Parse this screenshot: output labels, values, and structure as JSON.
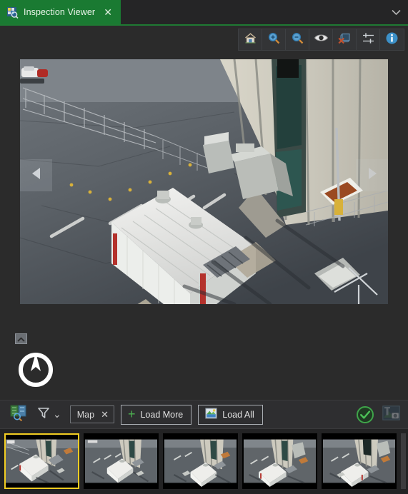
{
  "window": {
    "tab": {
      "label": "Inspection Viewer",
      "icon": "inspection-grid-magnifier-icon",
      "close_label": "✕",
      "active": true,
      "accent_color": "#1a7a32"
    },
    "chevron": "⌄",
    "background_color": "#2b2b2b"
  },
  "toolbar": {
    "buttons": [
      {
        "name": "home-reset-view",
        "icon": "home-icon",
        "label": "Home"
      },
      {
        "name": "zoom-in",
        "icon": "zoom-in-icon",
        "label": "Zoom In"
      },
      {
        "name": "zoom-out",
        "icon": "zoom-out-icon",
        "label": "Zoom Out"
      },
      {
        "name": "visibility-toggle",
        "icon": "eye-icon",
        "label": "Show / Hide"
      },
      {
        "name": "clear-annotations",
        "icon": "delete-shape-icon",
        "label": "Clear"
      },
      {
        "name": "image-adjustments",
        "icon": "sliders-icon",
        "label": "Adjustments"
      },
      {
        "name": "information",
        "icon": "info-icon",
        "label": "Information"
      }
    ],
    "accent_blue": "#3c90c8",
    "accent_red": "#c0512e"
  },
  "viewer": {
    "prev_arrow": "◀",
    "next_arrow": "▶",
    "collapse_icon": "chevron-up-icon",
    "compass_icon": "compass-north-icon",
    "photo_alt": "Aerial inspection photo of building facade with parking lot and white container roof"
  },
  "actionbar": {
    "map_inspect_icon": "map-inspect-icon",
    "filter_icon": "filter-funnel-icon",
    "filter_chevron": "⌄",
    "chip": {
      "label": "Map",
      "close": "✕"
    },
    "load_more": {
      "label": "Load More",
      "icon": "plus-icon",
      "plus": "+"
    },
    "load_all": {
      "label": "Load All",
      "icon": "image-icon"
    },
    "status_badge": {
      "name": "success-check",
      "icon": "check-circle-icon",
      "color": "#3fa54a"
    },
    "capture_icon": "camera-photo-icon"
  },
  "filmstrip": {
    "selection_color": "#f2cd22",
    "thumbnails": [
      {
        "index": 1,
        "selected": true,
        "alt": "Inspection frame 1"
      },
      {
        "index": 2,
        "selected": false,
        "alt": "Inspection frame 2"
      },
      {
        "index": 3,
        "selected": false,
        "alt": "Inspection frame 3"
      },
      {
        "index": 4,
        "selected": false,
        "alt": "Inspection frame 4"
      },
      {
        "index": 5,
        "selected": false,
        "alt": "Inspection frame 5"
      }
    ]
  }
}
